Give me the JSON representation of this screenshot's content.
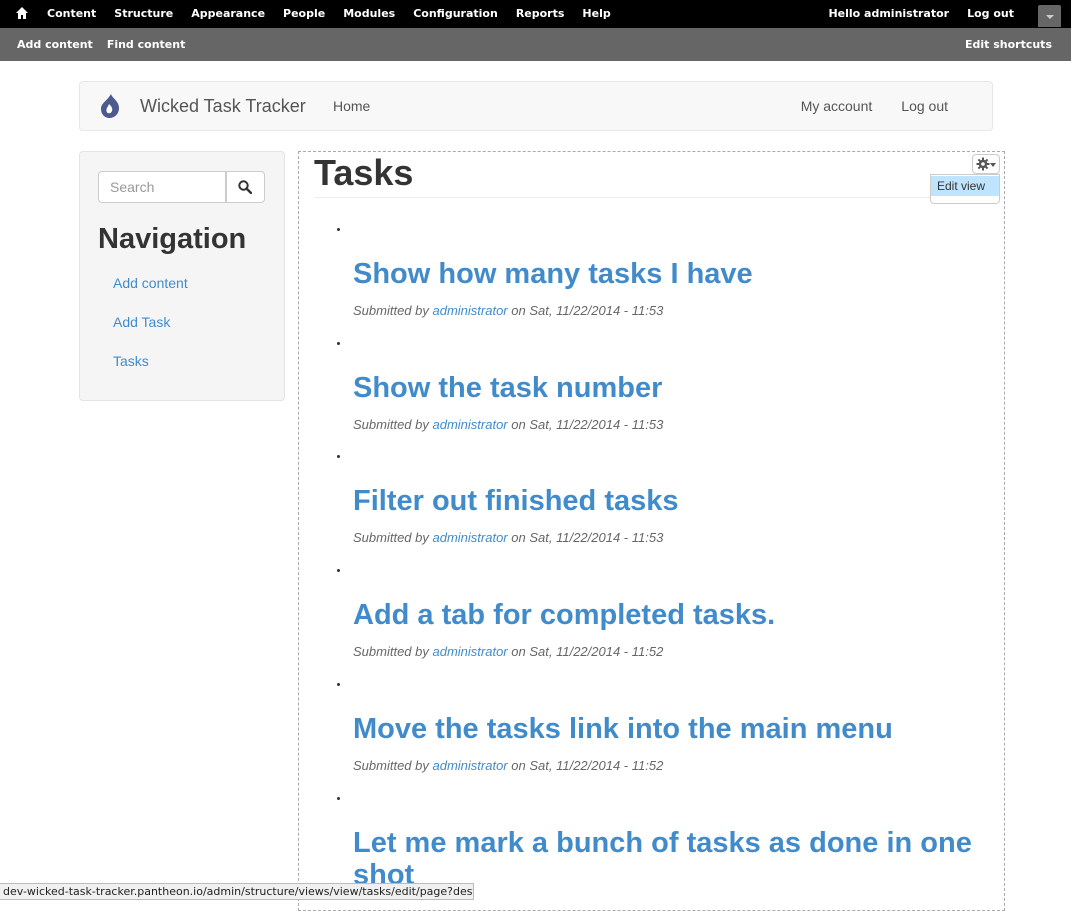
{
  "admin_bar": {
    "menu": [
      "Content",
      "Structure",
      "Appearance",
      "People",
      "Modules",
      "Configuration",
      "Reports",
      "Help"
    ],
    "hello_prefix": "Hello ",
    "username": "administrator",
    "logout": "Log out"
  },
  "shortcuts": {
    "items": [
      "Add content",
      "Find content"
    ],
    "edit": "Edit shortcuts"
  },
  "header": {
    "site_name": "Wicked Task Tracker",
    "home": "Home",
    "my_account": "My account",
    "logout": "Log out"
  },
  "sidebar": {
    "search_placeholder": "Search",
    "nav_title": "Navigation",
    "links": [
      "Add content",
      "Add Task",
      "Tasks"
    ]
  },
  "main": {
    "title": "Tasks",
    "edit_view": "Edit view",
    "submitted_by": "Submitted by",
    "on": "on",
    "tasks": [
      {
        "title": "Show how many tasks I have",
        "author": "administrator",
        "date": "Sat, 11/22/2014 - 11:53"
      },
      {
        "title": "Show the task number",
        "author": "administrator",
        "date": "Sat, 11/22/2014 - 11:53"
      },
      {
        "title": "Filter out finished tasks",
        "author": "administrator",
        "date": "Sat, 11/22/2014 - 11:53"
      },
      {
        "title": "Add a tab for completed tasks.",
        "author": "administrator",
        "date": "Sat, 11/22/2014 - 11:52"
      },
      {
        "title": "Move the tasks link into the main menu",
        "author": "administrator",
        "date": "Sat, 11/22/2014 - 11:52"
      },
      {
        "title": "Let me mark a bunch of tasks as done in one shot",
        "author": "",
        "date": ""
      }
    ]
  },
  "status_bar": {
    "url": "dev-wicked-task-tracker.pantheon.io/admin/structure/views/view/tasks/edit/page?destinatio"
  }
}
